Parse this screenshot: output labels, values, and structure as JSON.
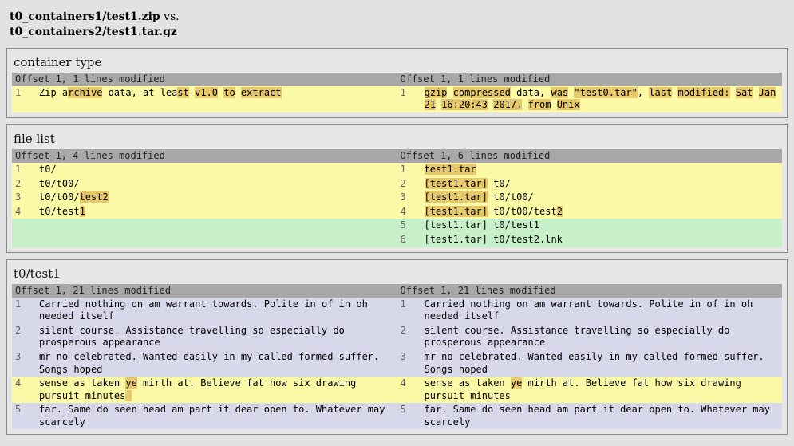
{
  "header": {
    "left": "t0_containers1/test1.zip",
    "sep": " vs.",
    "right": "t0_containers2/test1.tar.gz"
  },
  "sections": [
    {
      "title": "container type",
      "leftHeader": "Offset 1, 1 lines modified",
      "rightHeader": "Offset 1, 1 lines modified",
      "rows": [
        {
          "class": "r-yellow",
          "left": {
            "num": "1",
            "segments": [
              {
                "t": "Zip a"
              },
              {
                "t": "rchive",
                "h": 1
              },
              {
                "t": " data, at lea"
              },
              {
                "t": "st",
                "h": 1
              },
              {
                "t": " "
              },
              {
                "t": "v1.0",
                "h": 1
              },
              {
                "t": " "
              },
              {
                "t": "to",
                "h": 1
              },
              {
                "t": " "
              },
              {
                "t": "extract",
                "h": 1
              }
            ]
          },
          "right": {
            "num": "1",
            "segments": [
              {
                "t": "gzip",
                "h": 1
              },
              {
                "t": " "
              },
              {
                "t": "compressed",
                "h": 1
              },
              {
                "t": " data, "
              },
              {
                "t": "was",
                "h": 1
              },
              {
                "t": " "
              },
              {
                "t": "\"test0.tar\"",
                "h": 1
              },
              {
                "t": ", "
              },
              {
                "t": "last",
                "h": 1
              },
              {
                "t": " "
              },
              {
                "t": "modified:",
                "h": 1
              },
              {
                "t": " "
              },
              {
                "t": "Sat",
                "h": 1
              },
              {
                "t": " "
              },
              {
                "t": "Jan",
                "h": 1
              },
              {
                "t": " "
              },
              {
                "t": "21",
                "h": 1
              },
              {
                "t": " "
              },
              {
                "t": "16:20:43",
                "h": 1
              },
              {
                "t": " "
              },
              {
                "t": "2017,",
                "h": 1
              },
              {
                "t": " "
              },
              {
                "t": "from",
                "h": 1
              },
              {
                "t": " "
              },
              {
                "t": "Unix",
                "h": 1
              }
            ]
          }
        }
      ]
    },
    {
      "title": "file list",
      "leftHeader": "Offset 1, 4 lines modified",
      "rightHeader": "Offset 1, 6 lines modified",
      "rows": [
        {
          "class": "r-yellow",
          "left": {
            "num": "1",
            "segments": [
              {
                "t": "t0/"
              }
            ]
          },
          "right": {
            "num": "1",
            "segments": [
              {
                "t": "test1.tar",
                "h": 1
              }
            ]
          }
        },
        {
          "class": "r-yellow",
          "left": {
            "num": "2",
            "segments": [
              {
                "t": "t0/t00/"
              }
            ]
          },
          "right": {
            "num": "2",
            "segments": [
              {
                "t": "[test1.tar]",
                "h": 1
              },
              {
                "t": " t0/"
              }
            ]
          }
        },
        {
          "class": "r-yellow",
          "left": {
            "num": "3",
            "segments": [
              {
                "t": "t0/t00/"
              },
              {
                "t": "test2",
                "h": 1
              }
            ]
          },
          "right": {
            "num": "3",
            "segments": [
              {
                "t": "[test1.tar]",
                "h": 1
              },
              {
                "t": " t0/t00/"
              }
            ]
          }
        },
        {
          "class": "r-yellow",
          "left": {
            "num": "4",
            "segments": [
              {
                "t": "t0/test"
              },
              {
                "t": "1",
                "h": 1
              }
            ]
          },
          "right": {
            "num": "4",
            "segments": [
              {
                "t": "[test1.tar]",
                "h": 1
              },
              {
                "t": " t0/t00/test"
              },
              {
                "t": "2",
                "h": 1
              }
            ]
          }
        },
        {
          "class": "r-green",
          "left": null,
          "right": {
            "num": "5",
            "segments": [
              {
                "t": "[test1.tar] t0/test1"
              }
            ]
          }
        },
        {
          "class": "r-green",
          "left": null,
          "right": {
            "num": "6",
            "segments": [
              {
                "t": "[test1.tar] t0/test2.lnk"
              }
            ]
          }
        }
      ]
    },
    {
      "title": "t0/test1",
      "leftHeader": "Offset 1, 21 lines modified",
      "rightHeader": "Offset 1, 21 lines modified",
      "rows": [
        {
          "class": "r-blue",
          "left": {
            "num": "1",
            "segments": [
              {
                "t": "Carried nothing on am warrant towards. Polite in of in oh needed itself"
              }
            ]
          },
          "right": {
            "num": "1",
            "segments": [
              {
                "t": "Carried nothing on am warrant towards. Polite in of in oh needed itself"
              }
            ]
          }
        },
        {
          "class": "r-blue",
          "left": {
            "num": "2",
            "segments": [
              {
                "t": "silent course. Assistance travelling so especially do prosperous appearance"
              }
            ]
          },
          "right": {
            "num": "2",
            "segments": [
              {
                "t": "silent course. Assistance travelling so especially do prosperous appearance"
              }
            ]
          }
        },
        {
          "class": "r-blue",
          "left": {
            "num": "3",
            "segments": [
              {
                "t": "mr no celebrated. Wanted easily in my called formed suffer. Songs hoped"
              }
            ]
          },
          "right": {
            "num": "3",
            "segments": [
              {
                "t": "mr no celebrated. Wanted easily in my called formed suffer. Songs hoped"
              }
            ]
          }
        },
        {
          "class": "r-yellow",
          "left": {
            "num": "4",
            "segments": [
              {
                "t": "sense as taken "
              },
              {
                "t": "ye",
                "h": 1
              },
              {
                "t": " mirth at. Believe fat how six drawing pursuit minutes"
              },
              {
                "t": " ",
                "h": 1
              }
            ]
          },
          "right": {
            "num": "4",
            "segments": [
              {
                "t": "sense as taken "
              },
              {
                "t": "ye",
                "h": 1
              },
              {
                "t": " mirth at. Believe fat how six drawing pursuit minutes"
              }
            ]
          }
        },
        {
          "class": "r-blue",
          "left": {
            "num": "5",
            "segments": [
              {
                "t": "far. Same do seen head am part it dear open to. Whatever may scarcely"
              }
            ]
          },
          "right": {
            "num": "5",
            "segments": [
              {
                "t": "far. Same do seen head am part it dear open to. Whatever may scarcely"
              }
            ]
          }
        }
      ]
    }
  ]
}
